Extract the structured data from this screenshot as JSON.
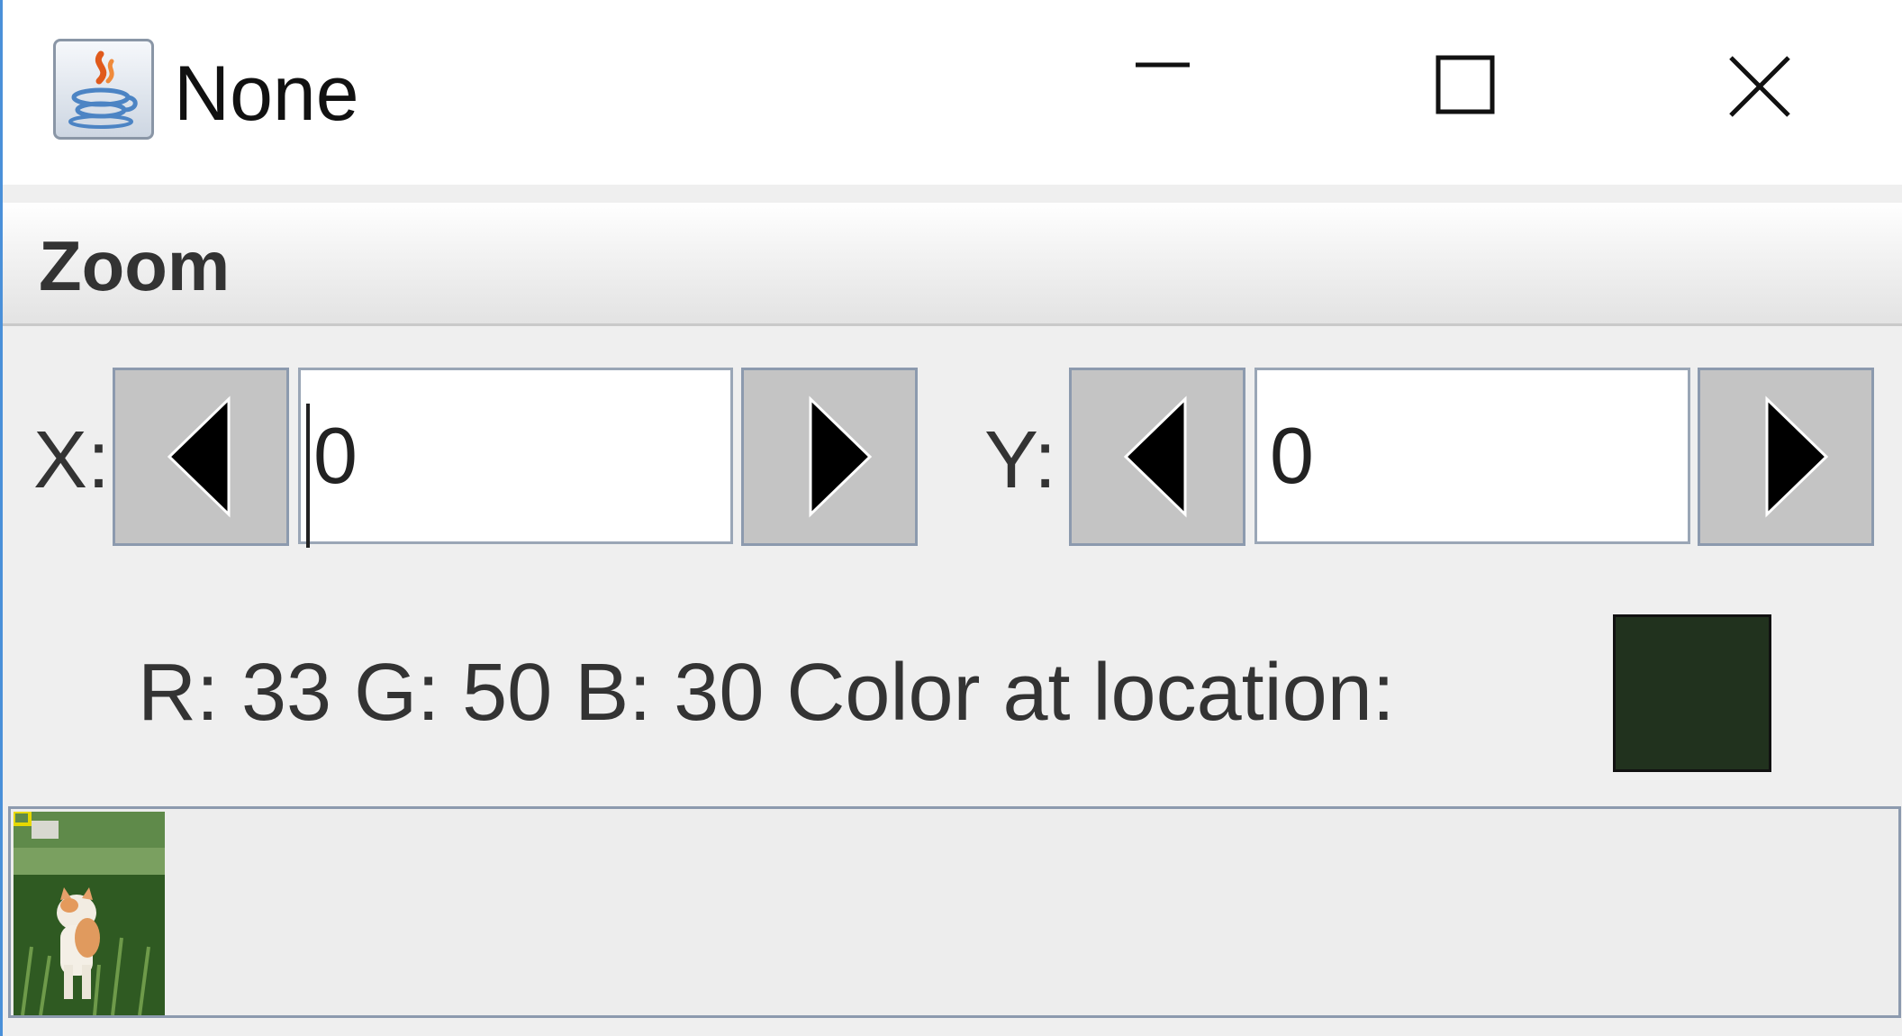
{
  "window": {
    "title": "None",
    "app_icon": "java-icon",
    "controls": {
      "minimize_icon": "minimize-icon",
      "maximize_icon": "maximize-icon",
      "close_icon": "close-icon"
    }
  },
  "menubar": {
    "items": [
      {
        "label": "Zoom"
      }
    ]
  },
  "coordinates": {
    "x_label": "X:",
    "x_value": "0",
    "y_label": "Y:",
    "y_value": "0",
    "decrement_icon": "triangle-left-icon",
    "increment_icon": "triangle-right-icon"
  },
  "color_info": {
    "readout": "R: 33 G: 50 B: 30 Color at location:",
    "swatch_color": "#21321e"
  },
  "image_panel": {
    "thumbnail": "cat-in-grass-image"
  }
}
